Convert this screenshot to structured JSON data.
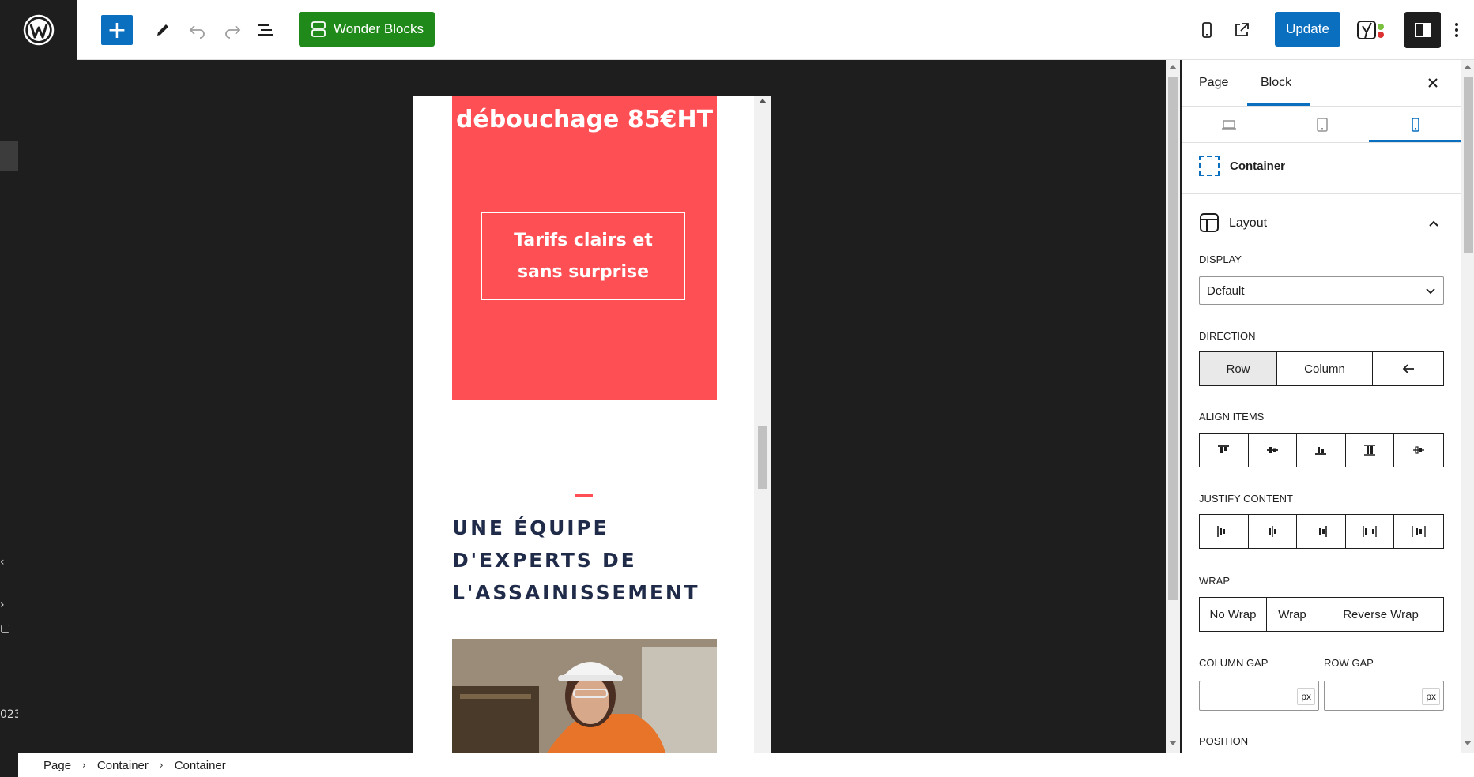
{
  "toolbar": {
    "add_label": "+",
    "wonder_blocks_label": "Wonder Blocks",
    "update_label": "Update"
  },
  "admin_strip": {
    "fragment_year": "023"
  },
  "canvas": {
    "price_text": "débouchage 85€HT",
    "tarifs_text": "Tarifs clairs et sans surprise",
    "heading_line1": "UNE ÉQUIPE",
    "heading_line2": "D'EXPERTS DE",
    "heading_line3": "L'ASSAINISSEMENT"
  },
  "sidebar": {
    "tabs": {
      "page": "Page",
      "block": "Block"
    },
    "block_name": "Container",
    "panel_title": "Layout",
    "display": {
      "label": "DISPLAY",
      "value": "Default"
    },
    "direction": {
      "label": "DIRECTION",
      "options": [
        "Row",
        "Column"
      ],
      "selected": "Row"
    },
    "align_items": {
      "label": "ALIGN ITEMS"
    },
    "justify_content": {
      "label": "JUSTIFY CONTENT"
    },
    "wrap": {
      "label": "WRAP",
      "options": [
        "No Wrap",
        "Wrap",
        "Reverse Wrap"
      ]
    },
    "column_gap": {
      "label": "COLUMN GAP",
      "unit": "px"
    },
    "row_gap": {
      "label": "ROW GAP",
      "unit": "px"
    },
    "position": {
      "label": "POSITION"
    }
  },
  "breadcrumb": [
    "Page",
    "Container",
    "Container"
  ],
  "colors": {
    "accent_blue": "#0a6fbf",
    "wonder_green": "#1f8a1a",
    "promo_red": "#fe4f55",
    "heading_navy": "#1f2b49"
  }
}
